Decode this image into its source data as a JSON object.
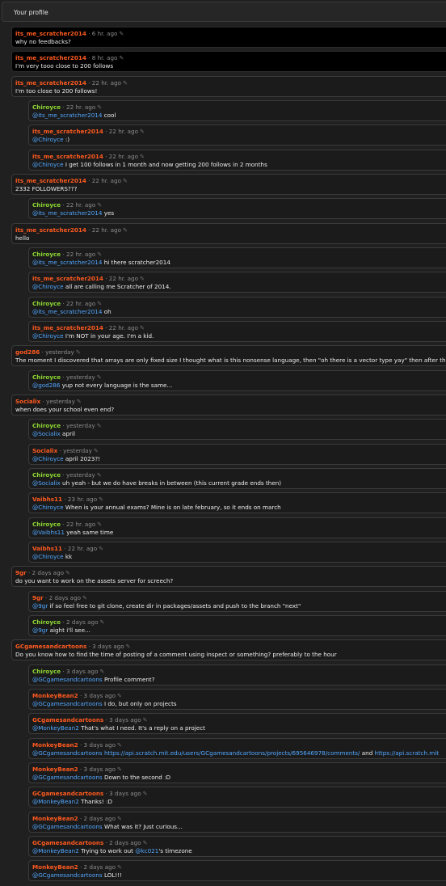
{
  "header": {
    "title": "Your profile"
  },
  "colors": {
    "user_orange": "#ff5a1f",
    "user_green": "#8ed831",
    "mention": "#52a7ff",
    "time": "#8d8d8d"
  },
  "icons": {
    "edit": "pencil-square-icon"
  },
  "comments": [
    {
      "author": "its_me_scratcher2014",
      "color": "orange",
      "time": "6 hr. ago",
      "parts": [
        {
          "t": "why no feedbacks?"
        }
      ],
      "indent": false,
      "dark": true
    },
    {
      "author": "its_me_scratcher2014",
      "color": "orange",
      "time": "8 hr. ago",
      "parts": [
        {
          "t": "I'm very tooo close to 200 follows"
        }
      ],
      "indent": false,
      "dark": true
    },
    {
      "author": "its_me_scratcher2014",
      "color": "orange",
      "time": "22 hr. ago",
      "parts": [
        {
          "t": "I'm too close to 200 follows!"
        }
      ],
      "indent": false
    },
    {
      "author": "Chiroyce",
      "color": "green",
      "time": "22 hr. ago",
      "parts": [
        {
          "m": "@its_me_scratcher2014"
        },
        {
          "t": " cool"
        }
      ],
      "indent": true
    },
    {
      "author": "its_me_scratcher2014",
      "color": "orange",
      "time": "22 hr. ago",
      "parts": [
        {
          "m": "@Chiroyce"
        },
        {
          "t": " :)"
        }
      ],
      "indent": true
    },
    {
      "author": "its_me_scratcher2014",
      "color": "orange",
      "time": "22 hr. ago",
      "parts": [
        {
          "m": "@Chiroyce"
        },
        {
          "t": " I get 100 follows in 1 month and now getting 200 follows in 2 months"
        }
      ],
      "indent": true
    },
    {
      "author": "its_me_scratcher2014",
      "color": "orange",
      "time": "22 hr. ago",
      "parts": [
        {
          "t": "2332 FOLLOWERS???"
        }
      ],
      "indent": false
    },
    {
      "author": "Chiroyce",
      "color": "green",
      "time": "22 hr. ago",
      "parts": [
        {
          "m": "@its_me_scratcher2014"
        },
        {
          "t": " yes"
        }
      ],
      "indent": true
    },
    {
      "author": "its_me_scratcher2014",
      "color": "orange",
      "time": "22 hr. ago",
      "parts": [
        {
          "t": "hello"
        }
      ],
      "indent": false
    },
    {
      "author": "Chiroyce",
      "color": "green",
      "time": "22 hr. ago",
      "parts": [
        {
          "m": "@its_me_scratcher2014"
        },
        {
          "t": " hi there scratcher2014"
        }
      ],
      "indent": true
    },
    {
      "author": "its_me_scratcher2014",
      "color": "orange",
      "time": "22 hr. ago",
      "parts": [
        {
          "m": "@Chiroyce"
        },
        {
          "t": " all are calling me Scratcher of 2014."
        }
      ],
      "indent": true
    },
    {
      "author": "Chiroyce",
      "color": "green",
      "time": "22 hr. ago",
      "parts": [
        {
          "m": "@its_me_scratcher2014"
        },
        {
          "t": " oh"
        }
      ],
      "indent": true
    },
    {
      "author": "its_me_scratcher2014",
      "color": "orange",
      "time": "22 hr. ago",
      "parts": [
        {
          "m": "@Chiroyce"
        },
        {
          "t": " I'm NOT in your age. I'm a kid."
        }
      ],
      "indent": true
    },
    {
      "author": "god286",
      "color": "orange",
      "time": "yesterday",
      "parts": [
        {
          "t": "The moment I discovered that arrays are only fixed size I thought what is this nonsense language, then \"oh there is a vector type yay\" then after that I"
        }
      ],
      "indent": false
    },
    {
      "author": "Chiroyce",
      "color": "green",
      "time": "yesterday",
      "parts": [
        {
          "m": "@god286"
        },
        {
          "t": " yup not every language is the same..."
        }
      ],
      "indent": true
    },
    {
      "author": "Socialix",
      "color": "orange",
      "time": "yesterday",
      "parts": [
        {
          "t": "when does your school even end?"
        }
      ],
      "indent": false
    },
    {
      "author": "Chiroyce",
      "color": "green",
      "time": "yesterday",
      "parts": [
        {
          "m": "@Socialix"
        },
        {
          "t": " april"
        }
      ],
      "indent": true
    },
    {
      "author": "Socialix",
      "color": "orange",
      "time": "yesterday",
      "parts": [
        {
          "m": "@Chiroyce"
        },
        {
          "t": " april 2023?!"
        }
      ],
      "indent": true
    },
    {
      "author": "Chiroyce",
      "color": "green",
      "time": "yesterday",
      "parts": [
        {
          "m": "@Socialix"
        },
        {
          "t": " uh yeah - but we do have breaks in between (this current grade ends then)"
        }
      ],
      "indent": true
    },
    {
      "author": "Vaibhs11",
      "color": "orange",
      "time": "23 hr. ago",
      "parts": [
        {
          "m": "@Chiroyce"
        },
        {
          "t": " When is your annual exams? Mine is on late february, so it ends on march"
        }
      ],
      "indent": true
    },
    {
      "author": "Chiroyce",
      "color": "green",
      "time": "22 hr. ago",
      "parts": [
        {
          "m": "@Vaibhs11"
        },
        {
          "t": " yeah same time"
        }
      ],
      "indent": true
    },
    {
      "author": "Vaibhs11",
      "color": "orange",
      "time": "22 hr. ago",
      "parts": [
        {
          "m": "@Chiroyce"
        },
        {
          "t": " kk"
        }
      ],
      "indent": true
    },
    {
      "author": "9gr",
      "color": "orange",
      "time": "2 days ago",
      "parts": [
        {
          "t": "do you want to work on the assets server for screech?"
        }
      ],
      "indent": false
    },
    {
      "author": "9gr",
      "color": "orange",
      "time": "2 days ago",
      "parts": [
        {
          "m": "@9gr"
        },
        {
          "t": " if so feel free to git clone, create dir in packages/assets and push to the branch \"next\""
        }
      ],
      "indent": true
    },
    {
      "author": "Chiroyce",
      "color": "green",
      "time": "2 days ago",
      "parts": [
        {
          "m": "@9gr"
        },
        {
          "t": " aight i'll see..."
        }
      ],
      "indent": true
    },
    {
      "author": "GCgamesandcartoons",
      "color": "orange",
      "time": "3 days ago",
      "parts": [
        {
          "t": "Do you know how to find the time of posting of a comment using inspect or something? preferably to the hour"
        }
      ],
      "indent": false
    },
    {
      "author": "Chiroyce",
      "color": "green",
      "time": "3 days ago",
      "parts": [
        {
          "m": "@GCgamesandcartoons"
        },
        {
          "t": " Profile comment?"
        }
      ],
      "indent": true
    },
    {
      "author": "MonkeyBean2",
      "color": "orange",
      "time": "3 days ago",
      "parts": [
        {
          "m": "@GCgamesandcartoons"
        },
        {
          "t": " I do, but only on projects"
        }
      ],
      "indent": true
    },
    {
      "author": "GCgamesandcartoons",
      "color": "orange",
      "time": "3 days ago",
      "parts": [
        {
          "m": "@MonkeyBean2"
        },
        {
          "t": " That's what I need. It's a reply on a project"
        }
      ],
      "indent": true
    },
    {
      "author": "MonkeyBean2",
      "color": "orange",
      "time": "3 days ago",
      "parts": [
        {
          "m": "@GCgamesandcartoons"
        },
        {
          "t": " "
        },
        {
          "l": "https://api.scratch.mit.edu/users/GCgamesandcartoons/projects/695646978/comments/"
        },
        {
          "t": " and "
        },
        {
          "l": "https://api.scratch.mit"
        }
      ],
      "indent": true
    },
    {
      "author": "MonkeyBean2",
      "color": "orange",
      "time": "3 days ago",
      "parts": [
        {
          "m": "@GCgamesandcartoons"
        },
        {
          "t": " Down to the second :D"
        }
      ],
      "indent": true
    },
    {
      "author": "GCgamesandcartoons",
      "color": "orange",
      "time": "3 days ago",
      "parts": [
        {
          "m": "@MonkeyBean2"
        },
        {
          "t": " Thanks! :D"
        }
      ],
      "indent": true
    },
    {
      "author": "MonkeyBean2",
      "color": "orange",
      "time": "2 days ago",
      "parts": [
        {
          "m": "@GCgamesandcartoons"
        },
        {
          "t": " What was it? Just curious..."
        }
      ],
      "indent": true
    },
    {
      "author": "GCgamesandcartoons",
      "color": "orange",
      "time": "2 days ago",
      "parts": [
        {
          "m": "@MonkeyBean2"
        },
        {
          "t": " Trying to work out "
        },
        {
          "m": "@kc021"
        },
        {
          "t": "'s timezone"
        }
      ],
      "indent": true
    },
    {
      "author": "MonkeyBean2",
      "color": "orange",
      "time": "2 days ago",
      "parts": [
        {
          "m": "@GCgamesandcartoons"
        },
        {
          "t": " LOL!!!"
        }
      ],
      "indent": true
    }
  ]
}
